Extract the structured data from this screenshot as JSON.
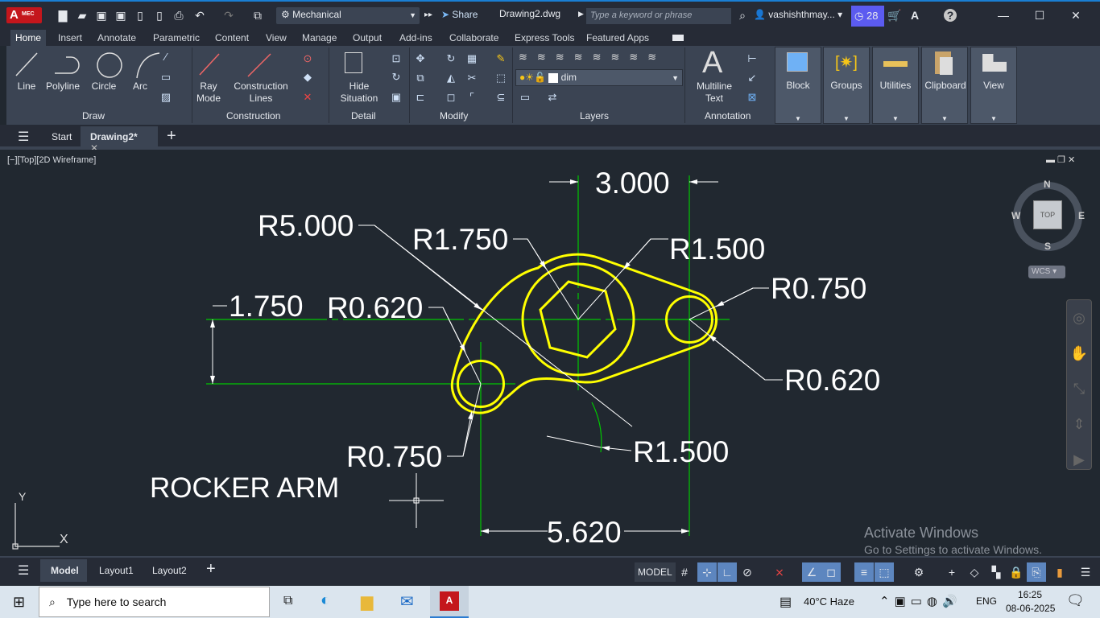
{
  "titlebar": {
    "app_badge": "A",
    "app_sub": "MEC",
    "workspace": "Mechanical",
    "share": "Share",
    "doc_title": "Drawing2.dwg",
    "search_placeholder": "Type a keyword or phrase",
    "user": "vashishthmay...",
    "timer_count": "28"
  },
  "ribbon_tabs": [
    "Home",
    "Insert",
    "Annotate",
    "Parametric",
    "Content",
    "View",
    "Manage",
    "Output",
    "Add-ins",
    "Collaborate",
    "Express Tools",
    "Featured Apps"
  ],
  "ribbon": {
    "draw": {
      "line": "Line",
      "polyline": "Polyline",
      "circle": "Circle",
      "arc": "Arc",
      "label": "Draw"
    },
    "construction": {
      "ray1": "Ray",
      "ray2": "Mode",
      "cl1": "Construction",
      "cl2": "Lines",
      "label": "Construction"
    },
    "detail": {
      "hide1": "Hide",
      "hide2": "Situation",
      "label": "Detail"
    },
    "modify": {
      "label": "Modify"
    },
    "layers": {
      "current": "dim",
      "label": "Layers"
    },
    "annotation": {
      "mt1": "Multiline",
      "mt2": "Text",
      "label": "Annotation"
    },
    "block": "Block",
    "groups": "Groups",
    "utilities": "Utilities",
    "clipboard": "Clipboard",
    "view": "View"
  },
  "filetabs": {
    "start": "Start",
    "drawing": "Drawing2*"
  },
  "viewport": {
    "label": "[−][Top][2D Wireframe]",
    "cube_top": "TOP",
    "n": "N",
    "s": "S",
    "e": "E",
    "w": "W",
    "wcs": "WCS",
    "ucs_x": "X",
    "ucs_y": "Y"
  },
  "drawing": {
    "dim_3": "3.000",
    "dim_1750": "1.750",
    "r5": "R5.000",
    "r1750": "R1.750",
    "r1500_top": "R1.500",
    "r0750_right": "R0.750",
    "r0620_right": "R0.620",
    "r0620_left": "R0.620",
    "r0750_left": "R0.750",
    "r1500_bottom": "R1.500",
    "dim_5620": "5.620",
    "title": "ROCKER ARM"
  },
  "colors": {
    "geometry": "#ffff00",
    "centerline": "#00c800",
    "dimension": "#ffffff"
  },
  "watermark": {
    "line1": "Activate Windows",
    "line2": "Go to Settings to activate Windows."
  },
  "layout_tabs": [
    "Model",
    "Layout1",
    "Layout2"
  ],
  "status": {
    "model": "MODEL"
  },
  "taskbar": {
    "search": "Type here to search",
    "weather": "40°C  Haze",
    "lang": "ENG",
    "time": "16:25",
    "date": "08-06-2025"
  }
}
